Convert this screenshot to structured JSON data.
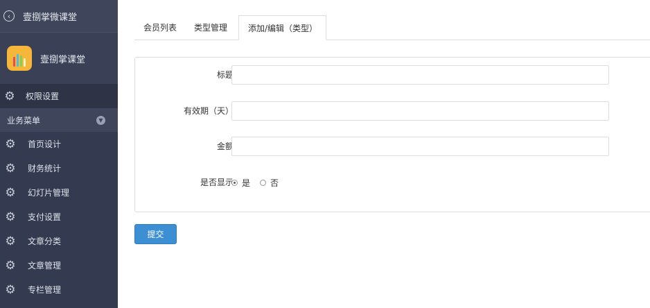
{
  "sidebar": {
    "app_name": "壹捌掌微课堂",
    "brand_name": "壹捌掌课堂",
    "permission_item": "权限设置",
    "section_title": "业务菜单",
    "items": [
      {
        "label": "首页设计"
      },
      {
        "label": "财务统计"
      },
      {
        "label": "幻灯片管理"
      },
      {
        "label": "支付设置"
      },
      {
        "label": "文章分类"
      },
      {
        "label": "文章管理"
      },
      {
        "label": "专栏管理"
      }
    ]
  },
  "tabs": [
    {
      "label": "会员列表"
    },
    {
      "label": "类型管理"
    },
    {
      "label": "添加/编辑（类型）"
    }
  ],
  "form": {
    "title_label": "标题",
    "title_value": "",
    "validity_label": "有效期（天）",
    "validity_value": "",
    "amount_label": "金额",
    "amount_value": "",
    "display_label": "是否显示",
    "display_options": [
      "是",
      "否"
    ],
    "display_selected": "是",
    "submit_label": "提交"
  },
  "colors": {
    "sidebar_bg": "#343a4f",
    "accent_button": "#3d8fd4"
  }
}
